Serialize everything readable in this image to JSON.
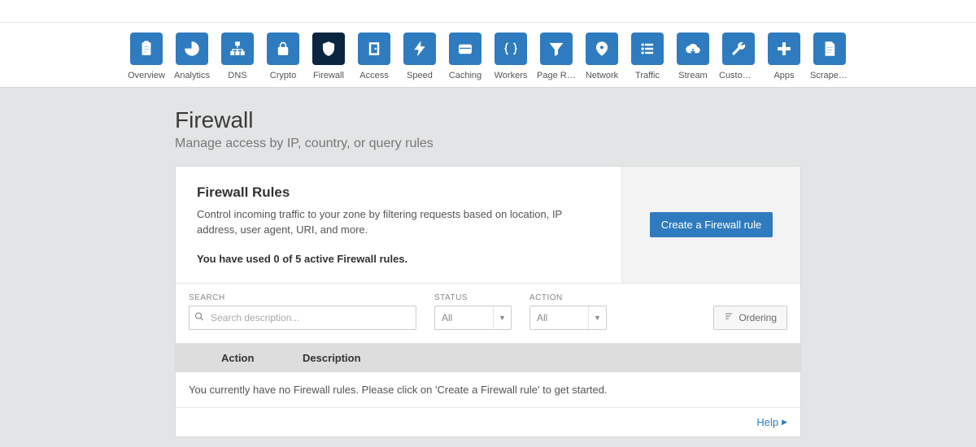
{
  "nav": {
    "items": [
      {
        "id": "overview",
        "label": "Overview",
        "icon": "clipboard"
      },
      {
        "id": "analytics",
        "label": "Analytics",
        "icon": "pie"
      },
      {
        "id": "dns",
        "label": "DNS",
        "icon": "sitemap"
      },
      {
        "id": "crypto",
        "label": "Crypto",
        "icon": "lock"
      },
      {
        "id": "firewall",
        "label": "Firewall",
        "icon": "shield",
        "active": true
      },
      {
        "id": "access",
        "label": "Access",
        "icon": "door"
      },
      {
        "id": "speed",
        "label": "Speed",
        "icon": "bolt"
      },
      {
        "id": "caching",
        "label": "Caching",
        "icon": "card"
      },
      {
        "id": "workers",
        "label": "Workers",
        "icon": "braces"
      },
      {
        "id": "pagerules",
        "label": "Page Rules",
        "icon": "funnel"
      },
      {
        "id": "network",
        "label": "Network",
        "icon": "pin"
      },
      {
        "id": "traffic",
        "label": "Traffic",
        "icon": "list"
      },
      {
        "id": "stream",
        "label": "Stream",
        "icon": "cloud"
      },
      {
        "id": "customp",
        "label": "Custom P...",
        "icon": "wrench"
      },
      {
        "id": "apps",
        "label": "Apps",
        "icon": "plus"
      },
      {
        "id": "scrape",
        "label": "Scrape Shi...",
        "icon": "doc"
      }
    ]
  },
  "page": {
    "title": "Firewall",
    "subtitle": "Manage access by IP, country, or query rules"
  },
  "rules_card": {
    "title": "Firewall Rules",
    "description": "Control incoming traffic to your zone by filtering requests based on location, IP address, user agent, URI, and more.",
    "usage_text": "You have used 0 of 5 active Firewall rules.",
    "create_button": "Create a Firewall rule"
  },
  "filters": {
    "search_label": "SEARCH",
    "search_placeholder": "Search description...",
    "status_label": "STATUS",
    "status_value": "All",
    "action_label": "ACTION",
    "action_value": "All",
    "ordering_button": "Ordering"
  },
  "table": {
    "col_action": "Action",
    "col_description": "Description",
    "empty_message": "You currently have no Firewall rules. Please click on 'Create a Firewall rule' to get started."
  },
  "help_link": "Help"
}
